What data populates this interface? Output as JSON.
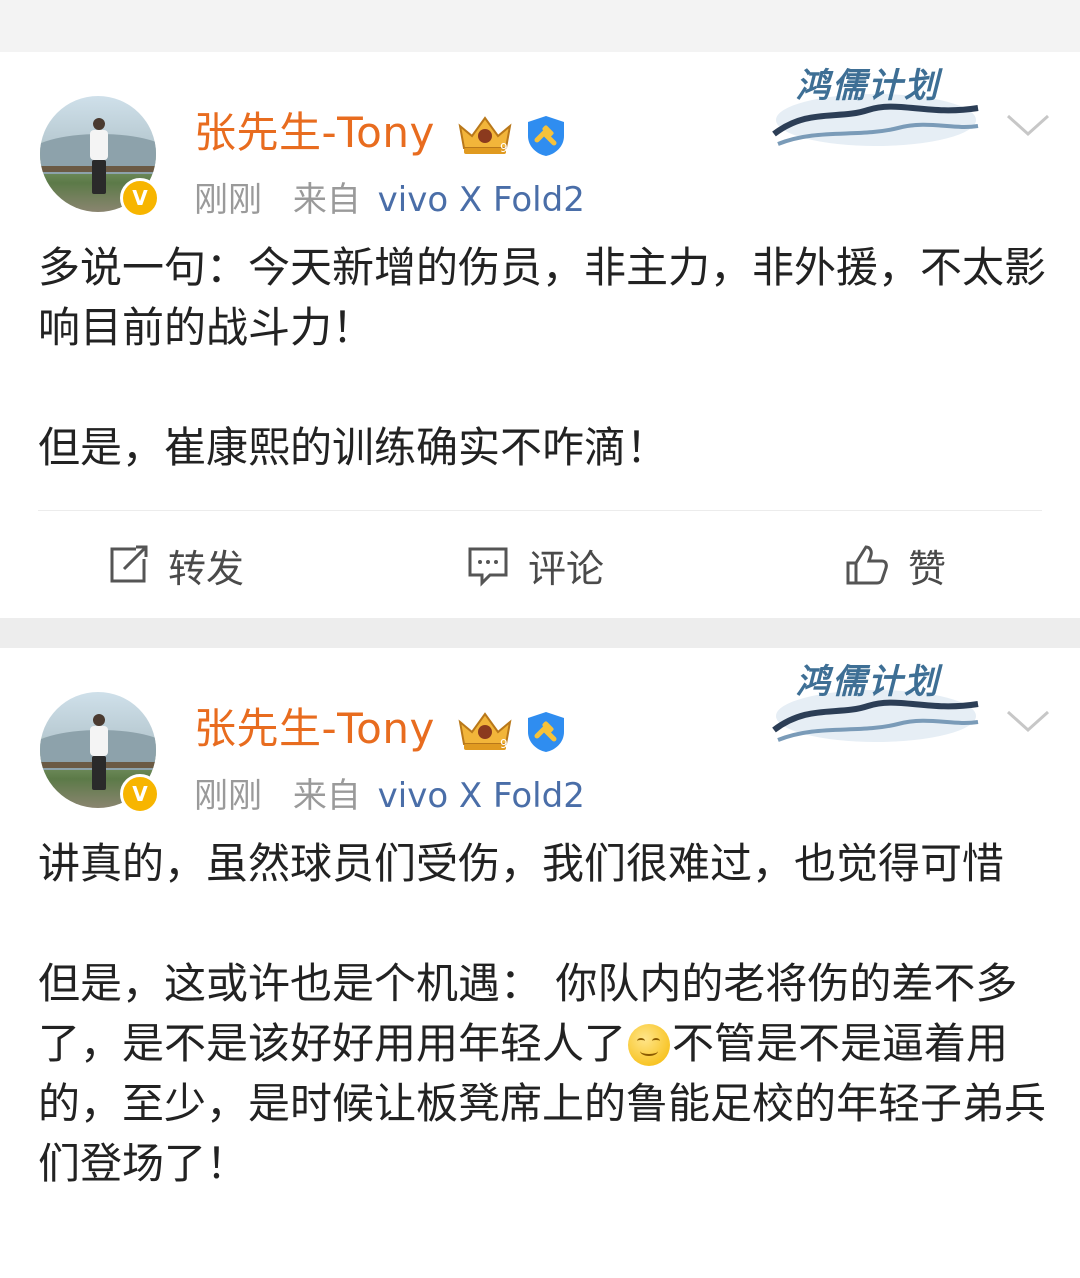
{
  "posts": [
    {
      "author": "张先生-Tony",
      "time": "刚刚",
      "source_prefix": "来自",
      "source": "vivo X Fold2",
      "banner": "鸿儒计划",
      "paragraphs": [
        "多说一句：今天新增的伤员，非主力，非外援，不太影响目前的战斗力！",
        "",
        "但是，崔康熙的训练确实不咋滴！"
      ],
      "actions": {
        "repost": "转发",
        "comment": "评论",
        "like": "赞"
      }
    },
    {
      "author": "张先生-Tony",
      "time": "刚刚",
      "source_prefix": "来自",
      "source": "vivo X Fold2",
      "banner": "鸿儒计划",
      "paragraphs": [
        "讲真的，虽然球员们受伤，我们很难过，也觉得可惜",
        "",
        "但是，这或许也是个机遇： 你队内的老将伤的差不多了，是不是该好好用用年轻人了",
        "不管是不是逼着用的，至少，是时候让板凳席上的鲁能足校的年轻子弟兵们登场了！"
      ]
    }
  ],
  "icons": {
    "crown": "crown-level-icon",
    "verified": "verified-shield-icon",
    "avatar_badge": "v-verified-badge-icon",
    "chevron": "chevron-down-icon",
    "emoji": "smile-emoji-icon",
    "repost": "repost-icon",
    "comment": "comment-icon",
    "like": "thumbs-up-icon"
  },
  "colors": {
    "author": "#e86c1f",
    "source": "#4a6ea8",
    "meta": "#9a9a9a",
    "banner": "#3e6f95"
  }
}
